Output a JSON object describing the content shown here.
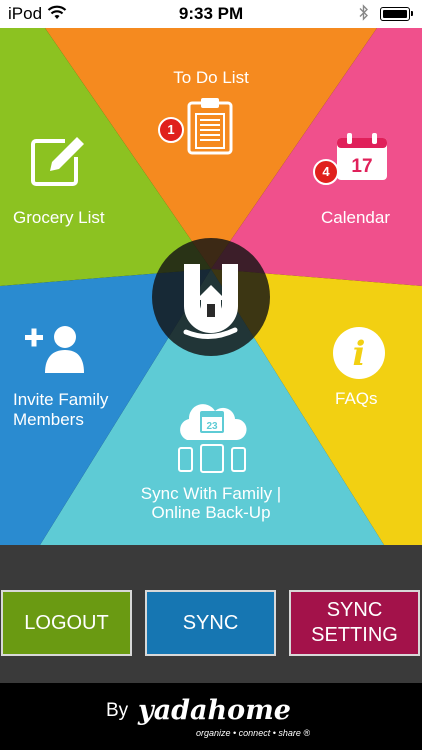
{
  "status_bar": {
    "carrier": "iPod",
    "time": "9:33 PM"
  },
  "tiles": {
    "todo": {
      "label": "To Do List",
      "badge": "1",
      "color": "#f58a1f"
    },
    "calendar": {
      "label": "Calendar",
      "badge": "4",
      "date": "17",
      "color": "#f0508c"
    },
    "grocery": {
      "label": "Grocery List",
      "color": "#8cc221"
    },
    "invite": {
      "label_line1": "Invite Family",
      "label_line2": "Members",
      "color": "#2a8bd0"
    },
    "faqs": {
      "label": "FAQs",
      "icon_text": "i",
      "color": "#f2d012"
    },
    "sync_family": {
      "label_line1": "Sync With Family |",
      "label_line2": "Online Back-Up",
      "cloud_date": "23",
      "color": "#5ecbd5"
    }
  },
  "buttons": {
    "logout": "LOGOUT",
    "sync": "SYNC",
    "sync_setting": "SYNC\nSETTING"
  },
  "footer": {
    "by": "By",
    "brand": "yadahome",
    "tagline": "organize • connect • share ®"
  },
  "icons": {
    "wifi": "wifi-icon",
    "bluetooth": "bluetooth-icon",
    "battery": "battery-icon",
    "clipboard": "clipboard-icon",
    "calendar": "calendar-icon",
    "edit": "edit-icon",
    "add_user": "add-user-icon",
    "info": "info-icon",
    "cloud_sync": "cloud-sync-icon",
    "logo": "yadahome-logo"
  }
}
